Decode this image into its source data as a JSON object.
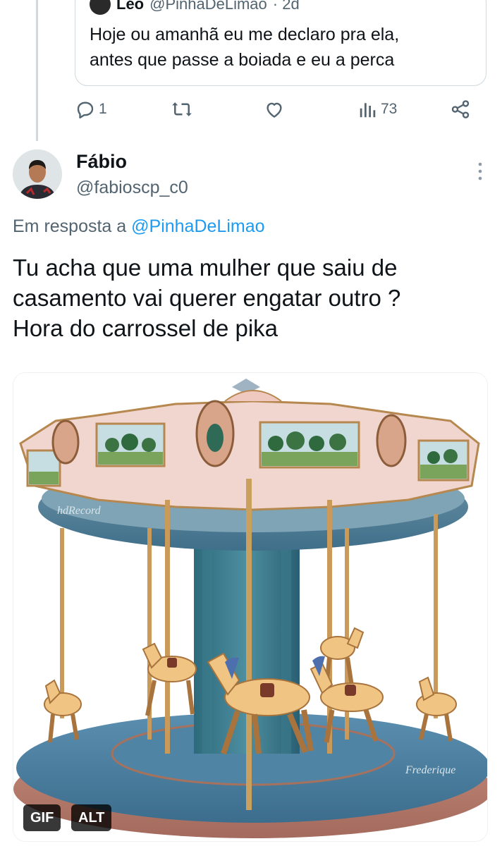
{
  "quoted_tweet": {
    "author_name": "Léo",
    "author_handle": "@PinhaDeLimao",
    "time": "· 2d",
    "text_line1": "Hoje ou amanhã eu me declaro pra ela,",
    "text_line2": "antes que passe a boiada e eu a perca"
  },
  "actions": {
    "replies": "1",
    "retweets": "",
    "likes": "",
    "views": "73"
  },
  "reply": {
    "author_name": "Fábio",
    "author_handle": "@fabioscp_c0",
    "reply_prefix": "Em resposta a",
    "reply_mention": "@PinhaDeLimao",
    "text_line1": "Tu acha que uma mulher que saiu de",
    "text_line2": "casamento vai querer engatar outro ?",
    "text_line3": "Hora do carrossel de pika"
  },
  "media": {
    "gif_badge": "GIF",
    "alt_badge": "ALT",
    "watermark_left": "hdRecord",
    "watermark_right": "Frederique"
  },
  "icons": {
    "reply": "reply-icon",
    "retweet": "retweet-icon",
    "like": "heart-icon",
    "views": "views-icon",
    "share": "share-icon",
    "more": "more-icon"
  },
  "colors": {
    "text": "#0f1419",
    "secondary": "#536471",
    "link": "#1d9bf0",
    "border": "#cfd9de"
  }
}
